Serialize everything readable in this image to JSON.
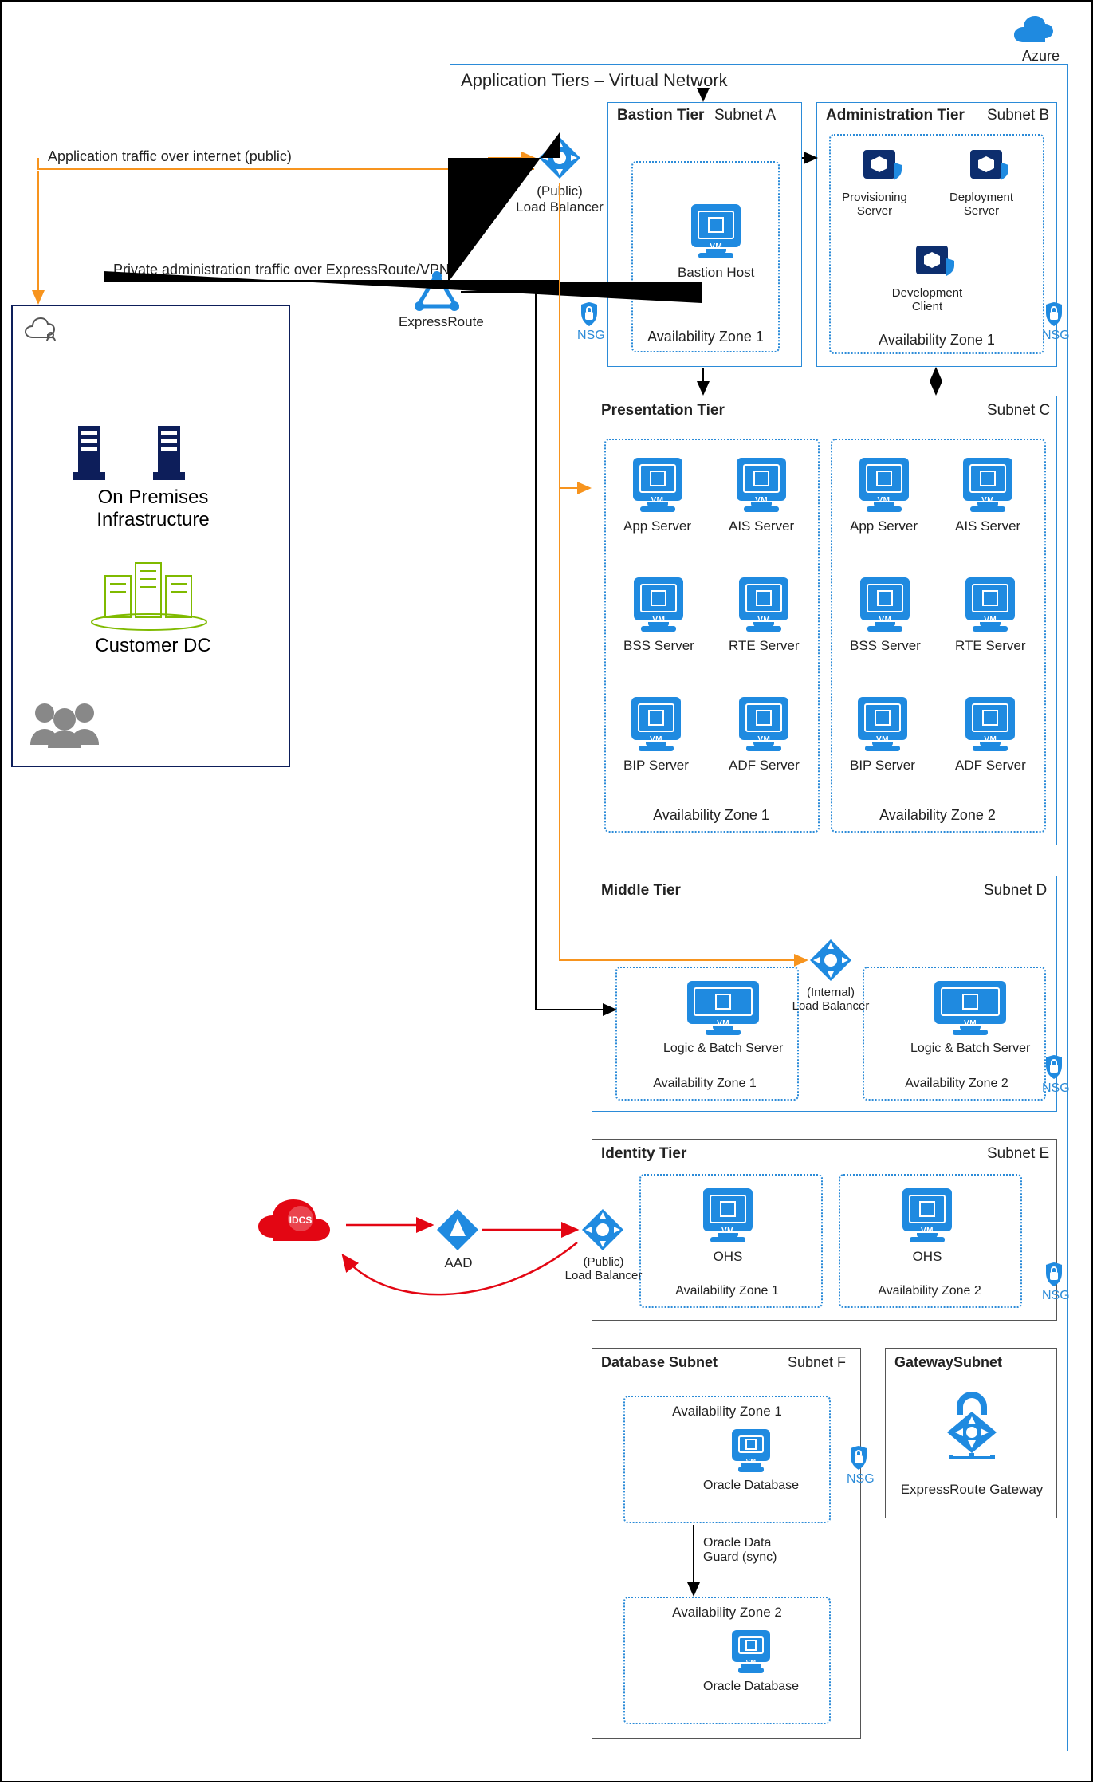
{
  "header": {
    "vnet_title": "Application Tiers – Virtual Network",
    "azure_label": "Azure"
  },
  "labels": {
    "app_traffic": "Application traffic over internet (public)",
    "admin_traffic": "Private administration traffic over ExpressRoute/VPN",
    "public_lb": "(Public)\nLoad Balancer",
    "internal_lb": "(Internal)\nLoad Balancer",
    "public_lb2": "(Public)\nLoad Balancer",
    "expressroute": "ExpressRoute",
    "nsg": "NSG",
    "aad": "AAD",
    "idcs": "IDCS",
    "onprem": "On Premises\nInfrastructure",
    "customer_dc": "Customer DC",
    "az1": "Availability Zone 1",
    "az2": "Availability Zone 2",
    "odg": "Oracle Data\nGuard (sync)"
  },
  "tiers": {
    "bastion": {
      "title": "Bastion Tier",
      "subnet": "Subnet A",
      "host": "Bastion Host"
    },
    "admin": {
      "title": "Administration Tier",
      "subnet": "Subnet B",
      "nodes": [
        "Provisioning\nServer",
        "Deployment\nServer",
        "Development\nClient"
      ]
    },
    "presentation": {
      "title": "Presentation Tier",
      "subnet": "Subnet C",
      "groupA": [
        "App Server",
        "AIS Server",
        "BSS Server",
        "RTE Server",
        "BIP Server",
        "ADF Server"
      ],
      "groupB": [
        "App Server",
        "AIS Server",
        "BSS Server",
        "RTE Server",
        "BIP Server",
        "ADF Server"
      ]
    },
    "middle": {
      "title": "Middle Tier",
      "subnet": "Subnet D",
      "node": "Logic & Batch Server"
    },
    "identity": {
      "title": "Identity Tier",
      "subnet": "Subnet E",
      "node": "OHS"
    },
    "db": {
      "title": "Database Subnet",
      "subnet": "Subnet F",
      "node": "Oracle Database"
    },
    "gateway": {
      "title": "GatewaySubnet",
      "node": "ExpressRoute Gateway"
    }
  }
}
